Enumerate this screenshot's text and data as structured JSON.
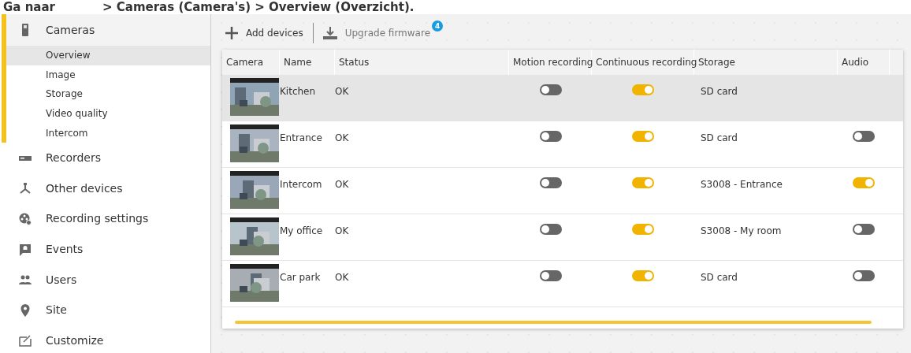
{
  "caption": {
    "lead": "Ga naar",
    "path": "> Cameras (Camera's) > Overview (Overzicht)."
  },
  "sidebar": {
    "items": [
      {
        "label": "Cameras",
        "expanded": true,
        "children": [
          {
            "label": "Overview",
            "selected": true
          },
          {
            "label": "Image",
            "selected": false
          },
          {
            "label": "Storage",
            "selected": false
          },
          {
            "label": "Video quality",
            "selected": false
          },
          {
            "label": "Intercom",
            "selected": false
          }
        ]
      },
      {
        "label": "Recorders",
        "expanded": false
      },
      {
        "label": "Other devices",
        "expanded": false
      },
      {
        "label": "Recording settings",
        "expanded": false
      },
      {
        "label": "Events",
        "expanded": false
      },
      {
        "label": "Users",
        "expanded": false
      },
      {
        "label": "Site",
        "expanded": false
      },
      {
        "label": "Customize",
        "expanded": false
      }
    ]
  },
  "toolbar": {
    "add_label": "Add devices",
    "upgrade_label": "Upgrade firmware",
    "upgrade_badge": "4"
  },
  "table": {
    "columns": [
      "Camera",
      "Name",
      "Status",
      "Motion recording",
      "Continuous recording",
      "Storage",
      "Audio"
    ],
    "rows": [
      {
        "name": "Kitchen",
        "status": "OK",
        "motion": false,
        "continuous": true,
        "storage": "SD card",
        "selected": true
      },
      {
        "name": "Entrance",
        "status": "OK",
        "motion": false,
        "continuous": true,
        "storage": "SD card",
        "audio": false,
        "selected": false
      },
      {
        "name": "Intercom",
        "status": "OK",
        "motion": false,
        "continuous": true,
        "storage": "S3008 - Entrance",
        "audio": true,
        "selected": false
      },
      {
        "name": "My office",
        "status": "OK",
        "motion": false,
        "continuous": true,
        "storage": "S3008 - My room",
        "audio": false,
        "selected": false
      },
      {
        "name": "Car park",
        "status": "OK",
        "motion": false,
        "continuous": true,
        "storage": "SD card",
        "audio": false,
        "selected": false
      }
    ]
  }
}
